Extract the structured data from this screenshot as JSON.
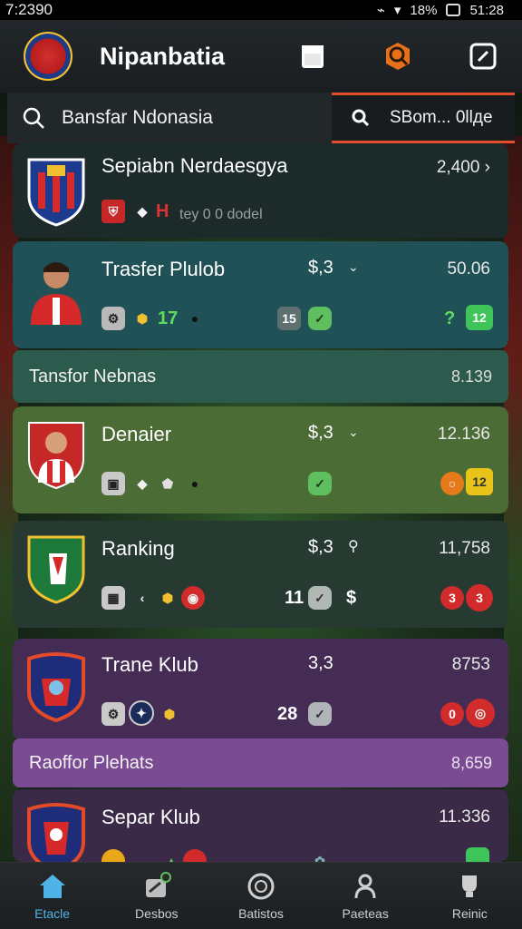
{
  "status_bar": {
    "time": "7:2390",
    "battery": "18%",
    "clock": "51:28"
  },
  "header": {
    "app_title": "Nipanbatia"
  },
  "search": {
    "left_text": "Bansfar Ndonasia",
    "right_text": "SBom... 0llде"
  },
  "cards": [
    {
      "title": "Sepiabn Nerdaesgya",
      "right_value": "2,400 ›",
      "meta": "H",
      "meta_sub": "tey  0 0 dodel"
    },
    {
      "title": "Trasfer Plulob",
      "mid_value": "$,3",
      "right_value": "50.06",
      "num_a": "17",
      "num_b": "15",
      "num_c": "12",
      "num_d": "?"
    },
    {
      "title": "Denaier",
      "mid_value": "$,3",
      "right_value": "12.136",
      "num_d": "12"
    },
    {
      "title": "Ranking",
      "mid_value": "$,3",
      "right_value": "11,758",
      "num_a": "11",
      "num_b": "3",
      "num_c": "$",
      "num_d": "3"
    },
    {
      "title": "Trane Klub",
      "mid_value": "3,3",
      "right_value": "8753",
      "num_a": "28",
      "num_d": "0"
    },
    {
      "title": "Separ Klub",
      "right_value": "11.336"
    }
  ],
  "bars": [
    {
      "label": "Tansfor Nebnas",
      "value": "8.139"
    },
    {
      "label": "Raoffor Plehats",
      "value": "8,659"
    }
  ],
  "nav": [
    {
      "label": "Etacle",
      "icon": "home-icon"
    },
    {
      "label": "Desbos",
      "icon": "transfer-icon"
    },
    {
      "label": "Batistos",
      "icon": "ball-icon"
    },
    {
      "label": "Paeteas",
      "icon": "player-icon"
    },
    {
      "label": "Reinic",
      "icon": "trophy-icon"
    }
  ],
  "colors": {
    "accent": "#e24d2a",
    "nav_active": "#4fb3e8",
    "card_teal": "#1f5156",
    "card_olive": "#4b6c35",
    "card_purple": "#452c55"
  }
}
